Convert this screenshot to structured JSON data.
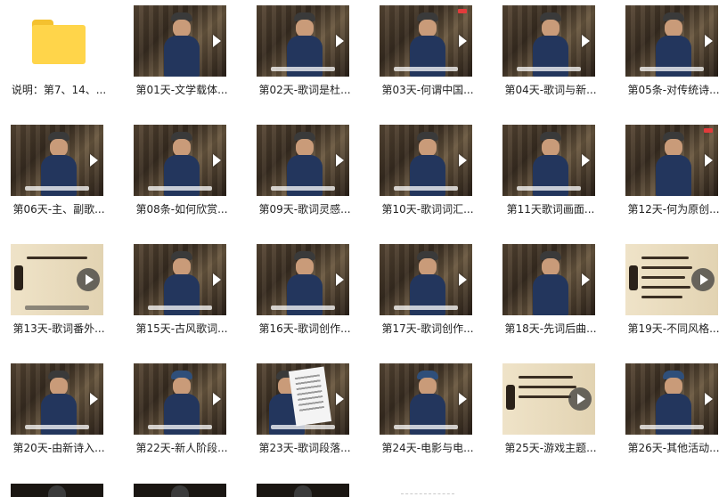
{
  "folder": {
    "label": "说明：第7、14、...",
    "icon": "folder-icon"
  },
  "videos": [
    {
      "label": "第01天-文学载体..."
    },
    {
      "label": "第02天-歌词是杜..."
    },
    {
      "label": "第03天-何谓中国..."
    },
    {
      "label": "第04天-歌词与新..."
    },
    {
      "label": "第05条-对传统诗..."
    },
    {
      "label": "第06天-主、副歌..."
    },
    {
      "label": "第08条-如何欣赏..."
    },
    {
      "label": "第09天-歌词灵感..."
    },
    {
      "label": "第10天-歌词词汇..."
    },
    {
      "label": "第11天歌词画面..."
    },
    {
      "label": "第12天-何为原创..."
    },
    {
      "label": "第13天-歌词番外..."
    },
    {
      "label": "第15天-古风歌词..."
    },
    {
      "label": "第16天-歌词创作..."
    },
    {
      "label": "第17天-歌词创作..."
    },
    {
      "label": "第18天-先词后曲..."
    },
    {
      "label": "第19天-不同风格..."
    },
    {
      "label": "第20天-由新诗入..."
    },
    {
      "label": "第22天-新人阶段..."
    },
    {
      "label": "第23天-歌词段落..."
    },
    {
      "label": "第24天-电影与电..."
    },
    {
      "label": "第25天-游戏主题..."
    },
    {
      "label": "第26天-其他活动..."
    }
  ],
  "colors": {
    "folder": "#ffd54a",
    "text": "#222222",
    "background": "#ffffff"
  }
}
